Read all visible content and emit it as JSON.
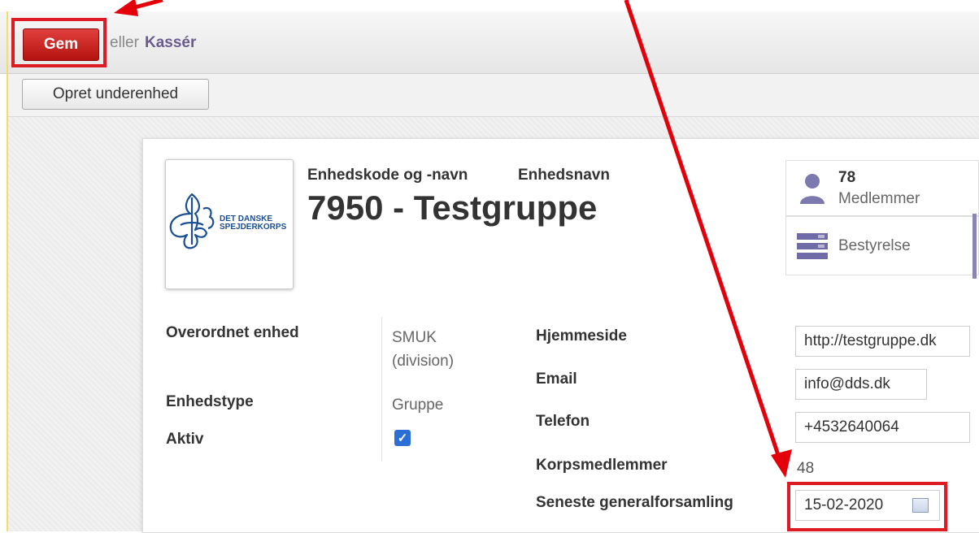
{
  "toolbar": {
    "save_label": "Gem",
    "or_text": "eller",
    "discard_label": "Kassér"
  },
  "subbar": {
    "create_sub_unit_label": "Opret underenhed"
  },
  "header": {
    "code_name_label": "Enhedskode og -navn",
    "unit_name_label": "Enhedsnavn",
    "unit_code": "7950",
    "separator": "-",
    "unit_name": "Testgruppe",
    "logo_line1": "DET DANSKE",
    "logo_line2": "SPEJDERKORPS"
  },
  "stats": {
    "members_count": "78",
    "members_label": "Medlemmer",
    "board_label": "Bestyrelse"
  },
  "fields_left": {
    "parent_label": "Overordnet enhed",
    "parent_value_line1": "SMUK",
    "parent_value_line2": "(division)",
    "type_label": "Enhedstype",
    "type_value": "Gruppe",
    "active_label": "Aktiv",
    "active_checked": true
  },
  "fields_right": {
    "website_label": "Hjemmeside",
    "website_value": "http://testgruppe.dk",
    "email_label": "Email",
    "email_value": "info@dds.dk",
    "phone_label": "Telefon",
    "phone_value": "+4532640064",
    "corps_members_label": "Korpsmedlemmer",
    "corps_members_value": "48",
    "last_assembly_label": "Seneste generalforsamling",
    "last_assembly_value": "15-02-2020"
  },
  "colors": {
    "save_button": "#c41f1c",
    "highlight": "#dc1b22",
    "arrow": "#e3000b",
    "checkbox": "#2b6fd6",
    "discard_link": "#6a5b8e"
  }
}
